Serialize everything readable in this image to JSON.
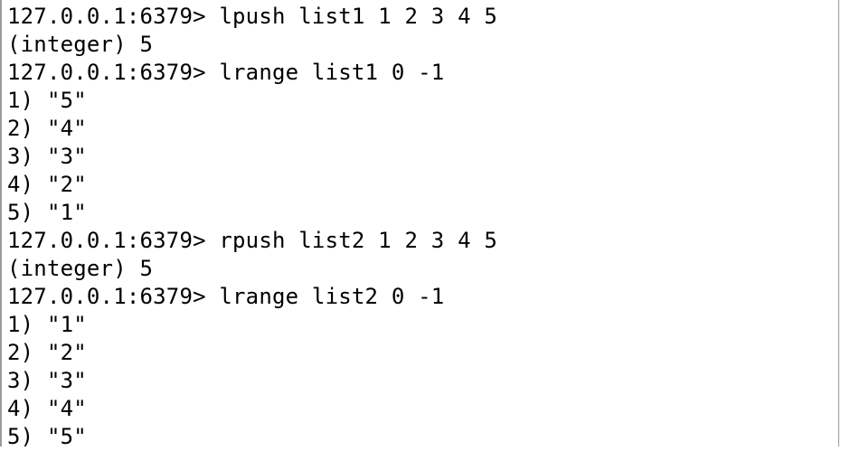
{
  "terminal": {
    "lines": [
      "127.0.0.1:6379> lpush list1 1 2 3 4 5",
      "(integer) 5",
      "127.0.0.1:6379> lrange list1 0 -1",
      "1) \"5\"",
      "2) \"4\"",
      "3) \"3\"",
      "4) \"2\"",
      "5) \"1\"",
      "127.0.0.1:6379> rpush list2 1 2 3 4 5",
      "(integer) 5",
      "127.0.0.1:6379> lrange list2 0 -1",
      "1) \"1\"",
      "2) \"2\"",
      "3) \"3\"",
      "4) \"4\"",
      "5) \"5\""
    ]
  }
}
